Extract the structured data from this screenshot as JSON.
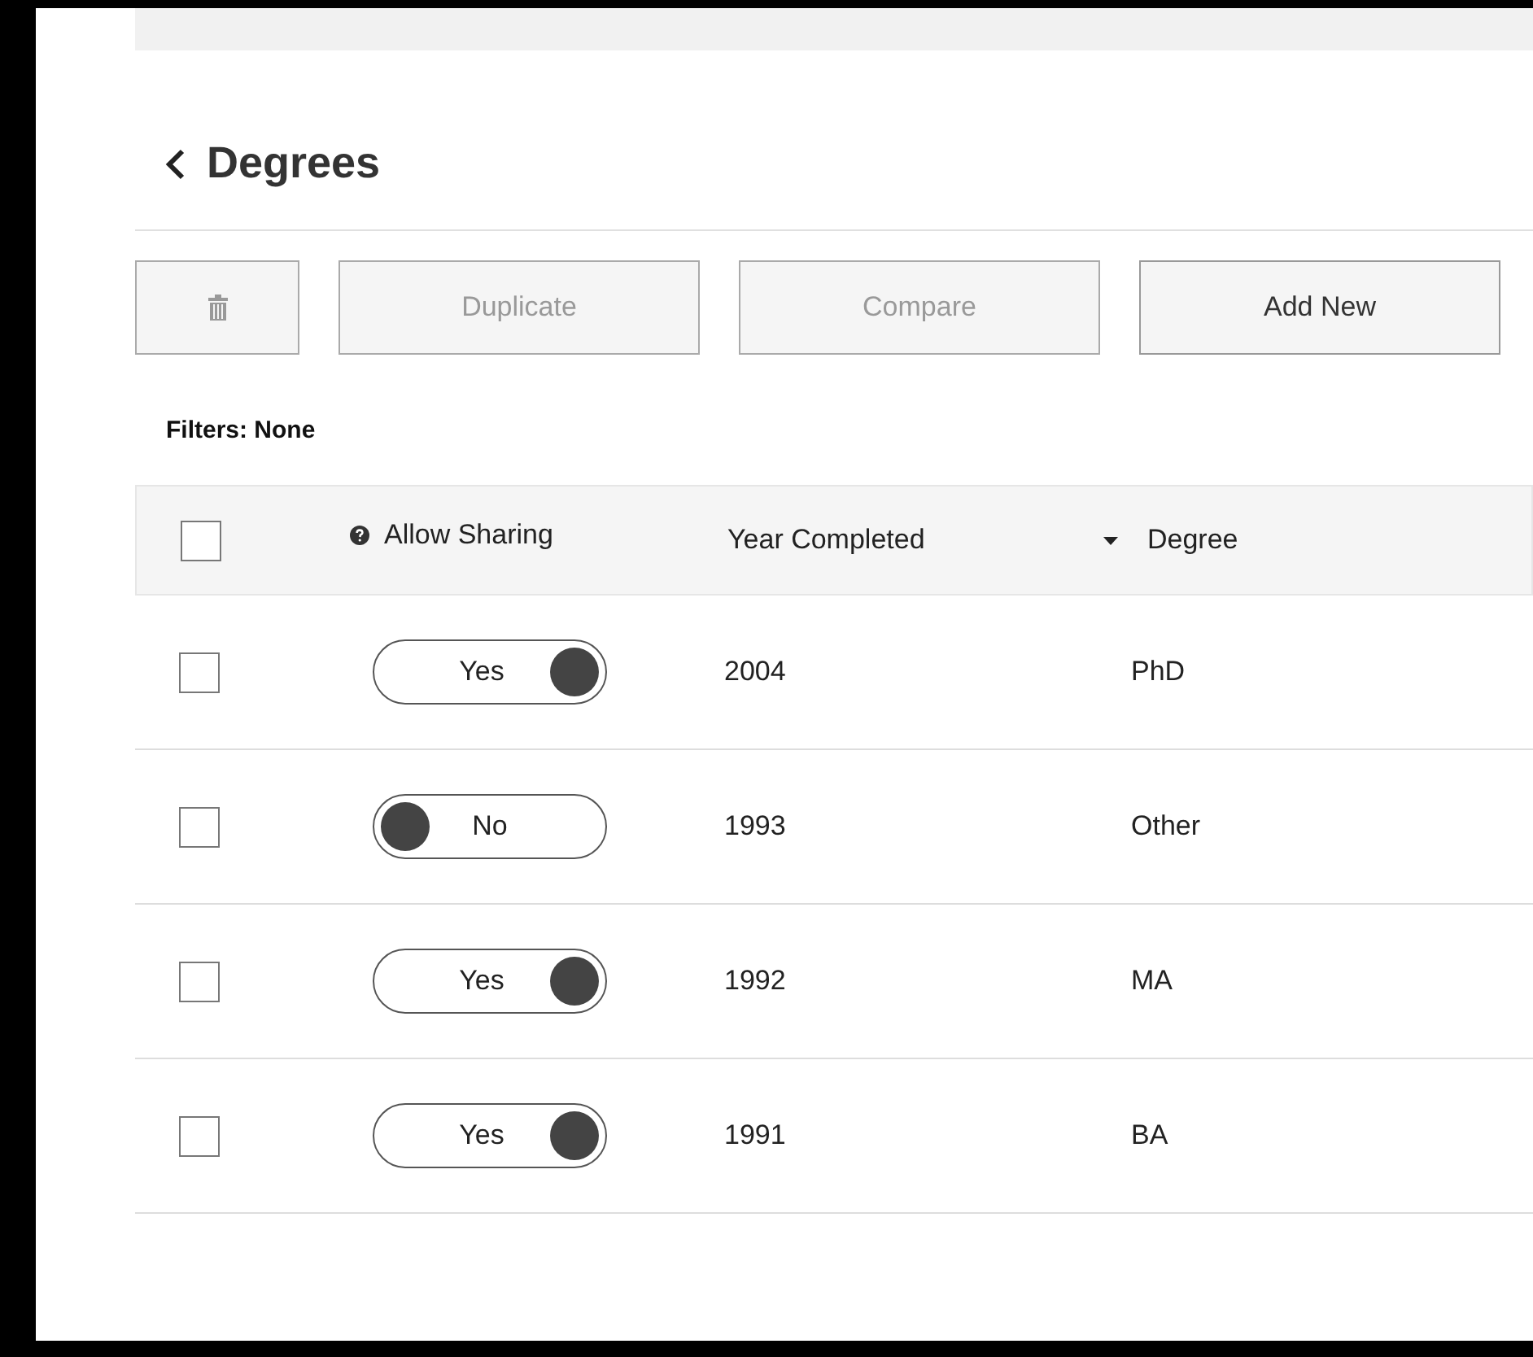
{
  "header": {
    "title": "Degrees"
  },
  "toolbar": [
    {
      "kind": "delete",
      "disabled": true
    },
    {
      "kind": "text",
      "label": "Duplicate",
      "disabled": true
    },
    {
      "kind": "text",
      "label": "Compare",
      "disabled": true
    },
    {
      "kind": "text",
      "label": "Add New",
      "disabled": false
    }
  ],
  "filters": "Filters: None",
  "table": {
    "select_all": {
      "checked": false
    },
    "columns": [
      {
        "label": "Allow Sharing",
        "kind": "help"
      },
      {
        "label": "Year Completed",
        "kind": "plain"
      },
      {
        "label": "Degree",
        "kind": "sorted"
      }
    ],
    "rows": [
      {
        "checked": false,
        "sharing": {
          "on": true,
          "label": "Yes"
        },
        "year": "2004",
        "degree": "PhD"
      },
      {
        "checked": false,
        "sharing": {
          "on": false,
          "label": "No"
        },
        "year": "1993",
        "degree": "Other"
      },
      {
        "checked": false,
        "sharing": {
          "on": true,
          "label": "Yes"
        },
        "year": "1992",
        "degree": "MA"
      },
      {
        "checked": false,
        "sharing": {
          "on": true,
          "label": "Yes"
        },
        "year": "1991",
        "degree": "BA"
      }
    ]
  }
}
